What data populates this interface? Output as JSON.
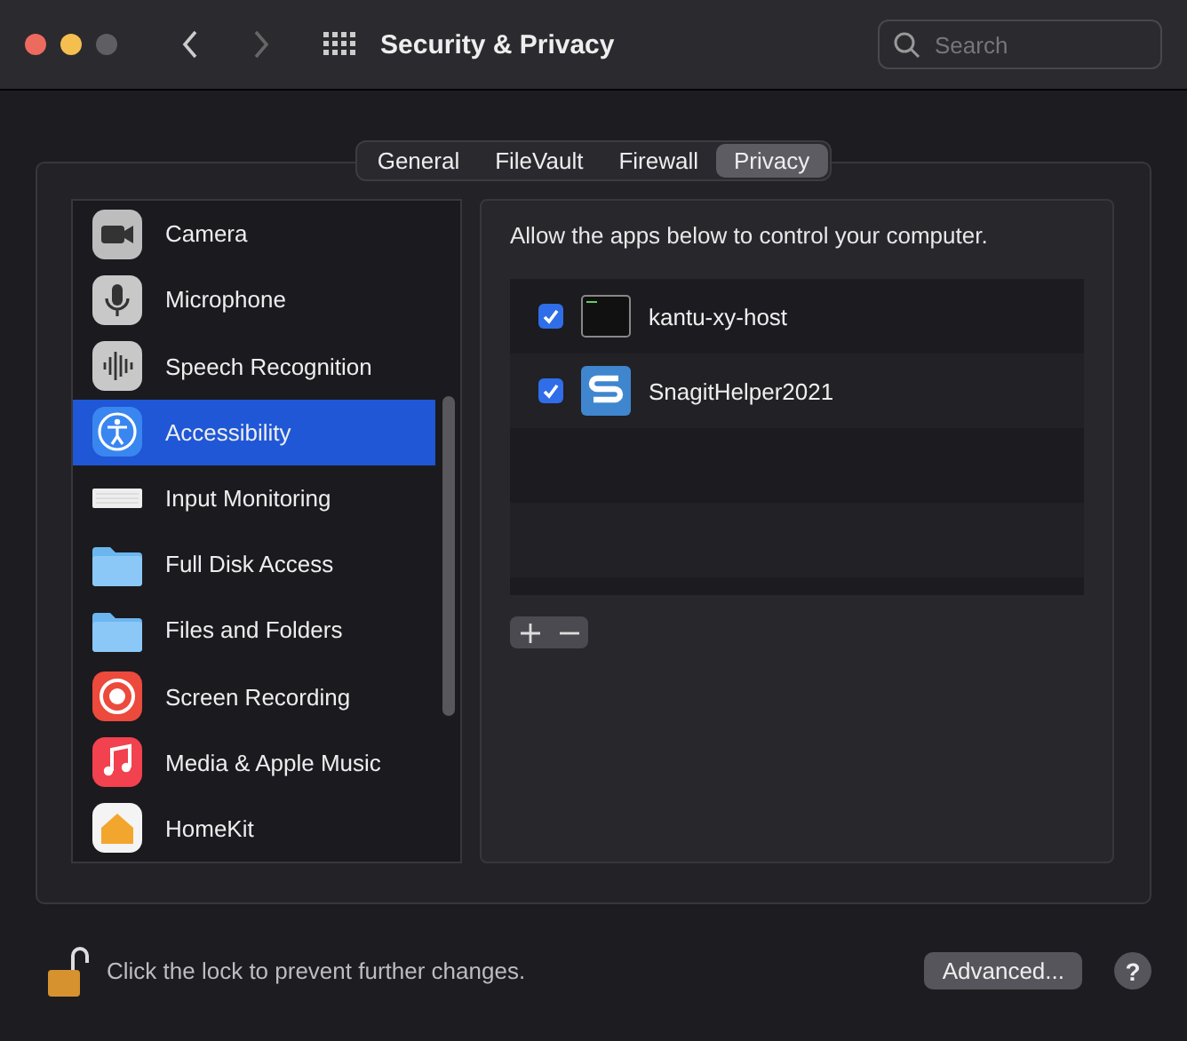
{
  "window": {
    "title": "Security & Privacy"
  },
  "search": {
    "placeholder": "Search"
  },
  "tabs": [
    {
      "label": "General",
      "selected": false
    },
    {
      "label": "FileVault",
      "selected": false
    },
    {
      "label": "Firewall",
      "selected": false
    },
    {
      "label": "Privacy",
      "selected": true
    }
  ],
  "sidebar": {
    "items": [
      {
        "label": "Camera",
        "kind": "camera",
        "selected": false
      },
      {
        "label": "Microphone",
        "kind": "microphone",
        "selected": false
      },
      {
        "label": "Speech Recognition",
        "kind": "speech",
        "selected": false
      },
      {
        "label": "Accessibility",
        "kind": "accessibility",
        "selected": true
      },
      {
        "label": "Input Monitoring",
        "kind": "keyboard",
        "selected": false
      },
      {
        "label": "Full Disk Access",
        "kind": "folder",
        "selected": false
      },
      {
        "label": "Files and Folders",
        "kind": "folder",
        "selected": false
      },
      {
        "label": "Screen Recording",
        "kind": "record",
        "selected": false
      },
      {
        "label": "Media & Apple Music",
        "kind": "music",
        "selected": false
      },
      {
        "label": "HomeKit",
        "kind": "home",
        "selected": false
      }
    ]
  },
  "detail": {
    "description": "Allow the apps below to control your computer.",
    "apps": [
      {
        "name": "kantu-xy-host",
        "kind": "terminal",
        "checked": true
      },
      {
        "name": "SnagitHelper2021",
        "kind": "snagit",
        "checked": true
      }
    ]
  },
  "footer": {
    "lock_text": "Click the lock to prevent further changes.",
    "advanced_button": "Advanced...",
    "help_button": "?"
  }
}
